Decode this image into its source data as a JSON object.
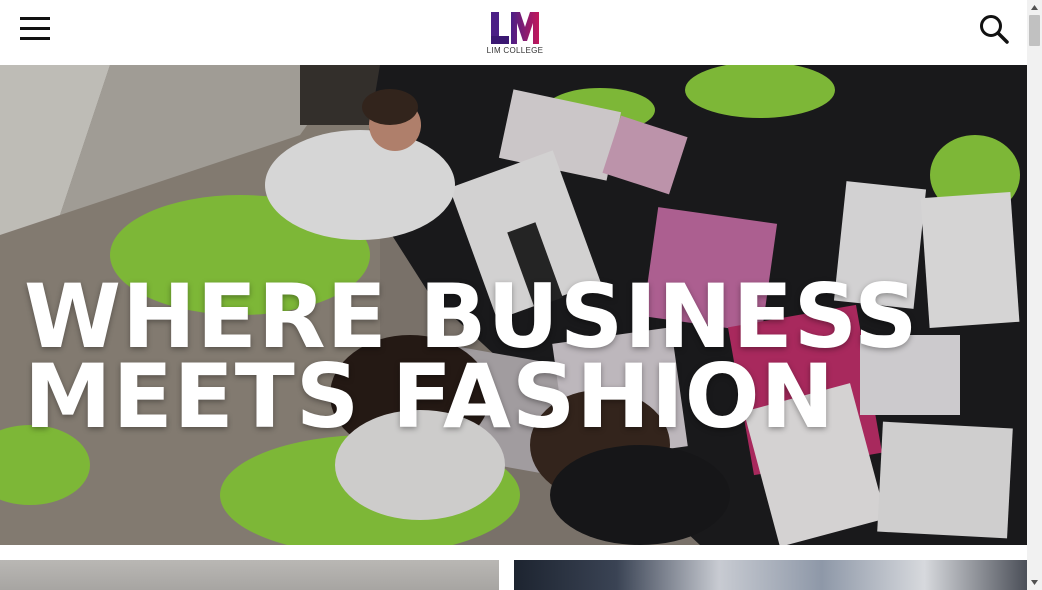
{
  "header": {
    "logo_letters": "LM",
    "logo_text": "LIM COLLEGE",
    "menu_icon": "hamburger-menu-icon",
    "search_icon": "search-icon"
  },
  "hero": {
    "title_line1": "WHERE BUSINESS",
    "title_line2": "MEETS FASHION"
  },
  "colors": {
    "logo_purple": "#4b1f86",
    "logo_magenta": "#c2185b",
    "hero_text": "#ffffff",
    "accent_green": "#8fd13f"
  }
}
